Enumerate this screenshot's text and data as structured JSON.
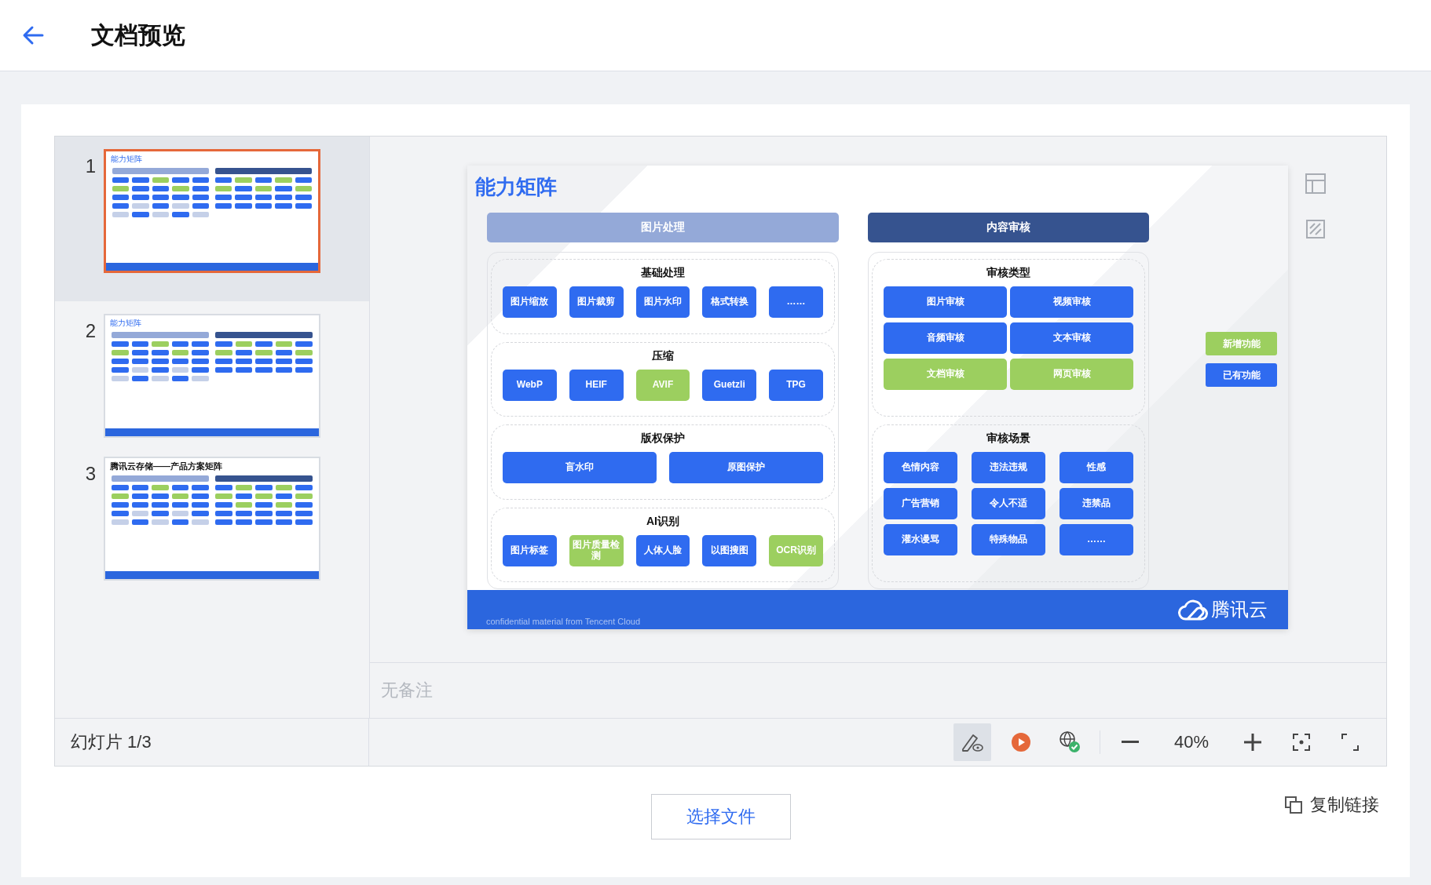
{
  "header": {
    "title": "文档预览"
  },
  "thumbnails": [
    {
      "number": "1",
      "title": "能力矩阵",
      "selected": true
    },
    {
      "number": "2",
      "title": "能力矩阵",
      "selected": false
    },
    {
      "number": "3",
      "title": "腾讯云存储——产品方案矩阵",
      "selected": false
    }
  ],
  "slide": {
    "title": "能力矩阵",
    "columns": [
      {
        "heading": "图片处理",
        "kind": "light",
        "groups": [
          {
            "title": "基础处理",
            "rows": [
              [
                {
                  "label": "图片缩放",
                  "kind": "existing"
                },
                {
                  "label": "图片裁剪",
                  "kind": "existing"
                },
                {
                  "label": "图片水印",
                  "kind": "existing"
                },
                {
                  "label": "格式转换",
                  "kind": "existing"
                },
                {
                  "label": "……",
                  "kind": "existing"
                }
              ]
            ]
          },
          {
            "title": "压缩",
            "rows": [
              [
                {
                  "label": "WebP",
                  "kind": "existing"
                },
                {
                  "label": "HEIF",
                  "kind": "existing"
                },
                {
                  "label": "AVIF",
                  "kind": "new"
                },
                {
                  "label": "Guetzli",
                  "kind": "existing"
                },
                {
                  "label": "TPG",
                  "kind": "existing"
                }
              ]
            ]
          },
          {
            "title": "版权保护",
            "rows": [
              [
                {
                  "label": "盲水印",
                  "kind": "existing"
                },
                {
                  "label": "原图保护",
                  "kind": "existing"
                }
              ]
            ]
          },
          {
            "title": "AI识别",
            "rows": [
              [
                {
                  "label": "图片标签",
                  "kind": "existing"
                },
                {
                  "label": "图片质量检测",
                  "kind": "new"
                },
                {
                  "label": "人体人脸",
                  "kind": "existing"
                },
                {
                  "label": "以图搜图",
                  "kind": "existing"
                },
                {
                  "label": "OCR识别",
                  "kind": "new"
                }
              ]
            ]
          }
        ]
      },
      {
        "heading": "内容审核",
        "kind": "dark",
        "groups": [
          {
            "title": "审核类型",
            "rows": [
              [
                {
                  "label": "图片审核",
                  "kind": "existing"
                },
                {
                  "label": "视频审核",
                  "kind": "existing"
                }
              ],
              [
                {
                  "label": "音频审核",
                  "kind": "existing"
                },
                {
                  "label": "文本审核",
                  "kind": "existing"
                }
              ],
              [
                {
                  "label": "文档审核",
                  "kind": "new"
                },
                {
                  "label": "网页审核",
                  "kind": "new"
                }
              ]
            ]
          },
          {
            "title": "审核场景",
            "rows": [
              [
                {
                  "label": "色情内容",
                  "kind": "existing"
                },
                {
                  "label": "违法违规",
                  "kind": "existing"
                },
                {
                  "label": "性感",
                  "kind": "existing"
                }
              ],
              [
                {
                  "label": "广告营销",
                  "kind": "existing"
                },
                {
                  "label": "令人不适",
                  "kind": "existing"
                },
                {
                  "label": "违禁品",
                  "kind": "existing"
                }
              ],
              [
                {
                  "label": "灌水谩骂",
                  "kind": "existing"
                },
                {
                  "label": "特殊物品",
                  "kind": "existing"
                },
                {
                  "label": "……",
                  "kind": "existing"
                }
              ]
            ]
          }
        ]
      }
    ],
    "legend": [
      {
        "label": "新增功能",
        "kind": "new"
      },
      {
        "label": "已有功能",
        "kind": "existing"
      }
    ],
    "footer_note": "confidential material from Tencent Cloud",
    "logo": "腾讯云"
  },
  "notes": "无备注",
  "toolbar": {
    "slide_counter": "幻灯片 1/3",
    "annotate_selected": true,
    "zoom": "40%"
  },
  "choose_file_button": "选择文件",
  "copy_link": "复制链接"
}
